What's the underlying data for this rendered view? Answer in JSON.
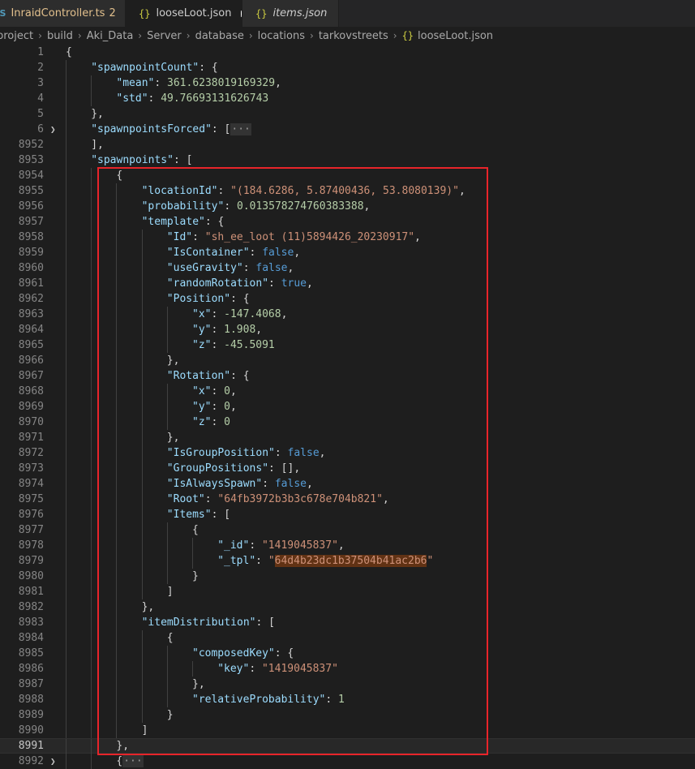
{
  "tabs": [
    {
      "icon": "TS",
      "label": "InraidController.ts",
      "badge": "2",
      "modified": true,
      "active": false
    },
    {
      "icon": "{}",
      "label": "looseLoot.json",
      "dirty": true,
      "active": true
    },
    {
      "icon": "{}",
      "label": "items.json",
      "italic": true,
      "active": false
    }
  ],
  "breadcrumb": [
    "project",
    "build",
    "Aki_Data",
    "Server",
    "database",
    "locations",
    "tarkovstreets",
    "looseLoot.json"
  ],
  "lines": [
    {
      "n": "1",
      "t": [
        [
          "p",
          "{"
        ]
      ]
    },
    {
      "n": "2",
      "i": 1,
      "t": [
        [
          "k",
          "\"spawnpointCount\""
        ],
        [
          "p",
          ": {"
        ]
      ]
    },
    {
      "n": "3",
      "i": 2,
      "t": [
        [
          "k",
          "\"mean\""
        ],
        [
          "p",
          ": "
        ],
        [
          "n",
          "361.6238019169329"
        ],
        [
          "p",
          ","
        ]
      ]
    },
    {
      "n": "4",
      "i": 2,
      "t": [
        [
          "k",
          "\"std\""
        ],
        [
          "p",
          ": "
        ],
        [
          "n",
          "49.76693131626743"
        ]
      ]
    },
    {
      "n": "5",
      "i": 1,
      "t": [
        [
          "p",
          "},"
        ]
      ]
    },
    {
      "n": "6",
      "i": 1,
      "fold": true,
      "t": [
        [
          "k",
          "\"spawnpointsForced\""
        ],
        [
          "p",
          ": ["
        ],
        [
          "ell",
          "···"
        ]
      ]
    },
    {
      "n": "8952",
      "i": 1,
      "t": [
        [
          "p",
          "],"
        ]
      ]
    },
    {
      "n": "8953",
      "i": 1,
      "t": [
        [
          "k",
          "\"spawnpoints\""
        ],
        [
          "p",
          ": ["
        ]
      ]
    },
    {
      "n": "8954",
      "i": 2,
      "t": [
        [
          "p",
          "{"
        ]
      ]
    },
    {
      "n": "8955",
      "i": 3,
      "t": [
        [
          "k",
          "\"locationId\""
        ],
        [
          "p",
          ": "
        ],
        [
          "s",
          "\"(184.6286, 5.87400436, 53.8080139)\""
        ],
        [
          "p",
          ","
        ]
      ]
    },
    {
      "n": "8956",
      "i": 3,
      "t": [
        [
          "k",
          "\"probability\""
        ],
        [
          "p",
          ": "
        ],
        [
          "n",
          "0.013578274760383388"
        ],
        [
          "p",
          ","
        ]
      ]
    },
    {
      "n": "8957",
      "i": 3,
      "t": [
        [
          "k",
          "\"template\""
        ],
        [
          "p",
          ": {"
        ]
      ]
    },
    {
      "n": "8958",
      "i": 4,
      "t": [
        [
          "k",
          "\"Id\""
        ],
        [
          "p",
          ": "
        ],
        [
          "s",
          "\"sh_ee_loot (11)5894426_20230917\""
        ],
        [
          "p",
          ","
        ]
      ]
    },
    {
      "n": "8959",
      "i": 4,
      "t": [
        [
          "k",
          "\"IsContainer\""
        ],
        [
          "p",
          ": "
        ],
        [
          "b",
          "false"
        ],
        [
          "p",
          ","
        ]
      ]
    },
    {
      "n": "8960",
      "i": 4,
      "t": [
        [
          "k",
          "\"useGravity\""
        ],
        [
          "p",
          ": "
        ],
        [
          "b",
          "false"
        ],
        [
          "p",
          ","
        ]
      ]
    },
    {
      "n": "8961",
      "i": 4,
      "t": [
        [
          "k",
          "\"randomRotation\""
        ],
        [
          "p",
          ": "
        ],
        [
          "b",
          "true"
        ],
        [
          "p",
          ","
        ]
      ]
    },
    {
      "n": "8962",
      "i": 4,
      "t": [
        [
          "k",
          "\"Position\""
        ],
        [
          "p",
          ": {"
        ]
      ]
    },
    {
      "n": "8963",
      "i": 5,
      "t": [
        [
          "k",
          "\"x\""
        ],
        [
          "p",
          ": "
        ],
        [
          "n",
          "-147.4068"
        ],
        [
          "p",
          ","
        ]
      ]
    },
    {
      "n": "8964",
      "i": 5,
      "t": [
        [
          "k",
          "\"y\""
        ],
        [
          "p",
          ": "
        ],
        [
          "n",
          "1.908"
        ],
        [
          "p",
          ","
        ]
      ]
    },
    {
      "n": "8965",
      "i": 5,
      "t": [
        [
          "k",
          "\"z\""
        ],
        [
          "p",
          ": "
        ],
        [
          "n",
          "-45.5091"
        ]
      ]
    },
    {
      "n": "8966",
      "i": 4,
      "t": [
        [
          "p",
          "},"
        ]
      ]
    },
    {
      "n": "8967",
      "i": 4,
      "t": [
        [
          "k",
          "\"Rotation\""
        ],
        [
          "p",
          ": {"
        ]
      ]
    },
    {
      "n": "8968",
      "i": 5,
      "t": [
        [
          "k",
          "\"x\""
        ],
        [
          "p",
          ": "
        ],
        [
          "n",
          "0"
        ],
        [
          "p",
          ","
        ]
      ]
    },
    {
      "n": "8969",
      "i": 5,
      "t": [
        [
          "k",
          "\"y\""
        ],
        [
          "p",
          ": "
        ],
        [
          "n",
          "0"
        ],
        [
          "p",
          ","
        ]
      ]
    },
    {
      "n": "8970",
      "i": 5,
      "t": [
        [
          "k",
          "\"z\""
        ],
        [
          "p",
          ": "
        ],
        [
          "n",
          "0"
        ]
      ]
    },
    {
      "n": "8971",
      "i": 4,
      "t": [
        [
          "p",
          "},"
        ]
      ]
    },
    {
      "n": "8972",
      "i": 4,
      "t": [
        [
          "k",
          "\"IsGroupPosition\""
        ],
        [
          "p",
          ": "
        ],
        [
          "b",
          "false"
        ],
        [
          "p",
          ","
        ]
      ]
    },
    {
      "n": "8973",
      "i": 4,
      "t": [
        [
          "k",
          "\"GroupPositions\""
        ],
        [
          "p",
          ": [],"
        ]
      ]
    },
    {
      "n": "8974",
      "i": 4,
      "t": [
        [
          "k",
          "\"IsAlwaysSpawn\""
        ],
        [
          "p",
          ": "
        ],
        [
          "b",
          "false"
        ],
        [
          "p",
          ","
        ]
      ]
    },
    {
      "n": "8975",
      "i": 4,
      "t": [
        [
          "k",
          "\"Root\""
        ],
        [
          "p",
          ": "
        ],
        [
          "s",
          "\"64fb3972b3b3c678e704b821\""
        ],
        [
          "p",
          ","
        ]
      ]
    },
    {
      "n": "8976",
      "i": 4,
      "t": [
        [
          "k",
          "\"Items\""
        ],
        [
          "p",
          ": ["
        ]
      ]
    },
    {
      "n": "8977",
      "i": 5,
      "t": [
        [
          "p",
          "{"
        ]
      ]
    },
    {
      "n": "8978",
      "i": 6,
      "t": [
        [
          "k",
          "\"_id\""
        ],
        [
          "p",
          ": "
        ],
        [
          "s",
          "\"1419045837\""
        ],
        [
          "p",
          ","
        ]
      ]
    },
    {
      "n": "8979",
      "i": 6,
      "t": [
        [
          "k",
          "\"_tpl\""
        ],
        [
          "p",
          ": "
        ],
        [
          "s",
          "\""
        ],
        [
          "shl",
          "64d4b23dc1b37504b41ac2b6"
        ],
        [
          "s",
          "\""
        ]
      ]
    },
    {
      "n": "8980",
      "i": 5,
      "t": [
        [
          "p",
          "}"
        ]
      ]
    },
    {
      "n": "8981",
      "i": 4,
      "t": [
        [
          "p",
          "]"
        ]
      ]
    },
    {
      "n": "8982",
      "i": 3,
      "t": [
        [
          "p",
          "},"
        ]
      ]
    },
    {
      "n": "8983",
      "i": 3,
      "t": [
        [
          "k",
          "\"itemDistribution\""
        ],
        [
          "p",
          ": ["
        ]
      ]
    },
    {
      "n": "8984",
      "i": 4,
      "t": [
        [
          "p",
          "{"
        ]
      ]
    },
    {
      "n": "8985",
      "i": 5,
      "t": [
        [
          "k",
          "\"composedKey\""
        ],
        [
          "p",
          ": {"
        ]
      ]
    },
    {
      "n": "8986",
      "i": 6,
      "t": [
        [
          "k",
          "\"key\""
        ],
        [
          "p",
          ": "
        ],
        [
          "s",
          "\"1419045837\""
        ]
      ]
    },
    {
      "n": "8987",
      "i": 5,
      "t": [
        [
          "p",
          "},"
        ]
      ]
    },
    {
      "n": "8988",
      "i": 5,
      "t": [
        [
          "k",
          "\"relativeProbability\""
        ],
        [
          "p",
          ": "
        ],
        [
          "n",
          "1"
        ]
      ]
    },
    {
      "n": "8989",
      "i": 4,
      "t": [
        [
          "p",
          "}"
        ]
      ]
    },
    {
      "n": "8990",
      "i": 3,
      "t": [
        [
          "p",
          "]"
        ]
      ]
    },
    {
      "n": "8991",
      "i": 2,
      "current": true,
      "t": [
        [
          "p",
          "},"
        ]
      ]
    },
    {
      "n": "8992",
      "i": 2,
      "fold": true,
      "t": [
        [
          "p",
          "{"
        ],
        [
          "ell",
          "···"
        ]
      ]
    }
  ],
  "colors": {
    "highlight_box": "#e8242a",
    "editor_bg": "#1e1e1e"
  }
}
